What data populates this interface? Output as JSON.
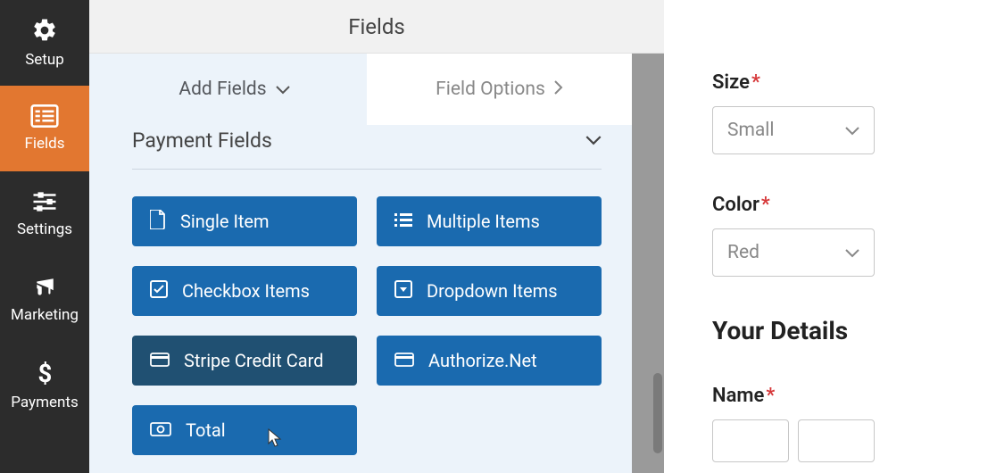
{
  "sidebar": {
    "items": [
      {
        "label": "Setup"
      },
      {
        "label": "Fields"
      },
      {
        "label": "Settings"
      },
      {
        "label": "Marketing"
      },
      {
        "label": "Payments"
      }
    ]
  },
  "topbar": {
    "title": "Fields"
  },
  "tabs": {
    "add_fields": "Add Fields",
    "field_options": "Field Options"
  },
  "section": {
    "title": "Payment Fields"
  },
  "fields": {
    "single_item": "Single Item",
    "multiple_items": "Multiple Items",
    "checkbox_items": "Checkbox Items",
    "dropdown_items": "Dropdown Items",
    "stripe": "Stripe Credit Card",
    "authorize": "Authorize.Net",
    "total": "Total"
  },
  "preview": {
    "size_label": "Size",
    "size_value": "Small",
    "color_label": "Color",
    "color_value": "Red",
    "details_heading": "Your Details",
    "name_label": "Name"
  }
}
